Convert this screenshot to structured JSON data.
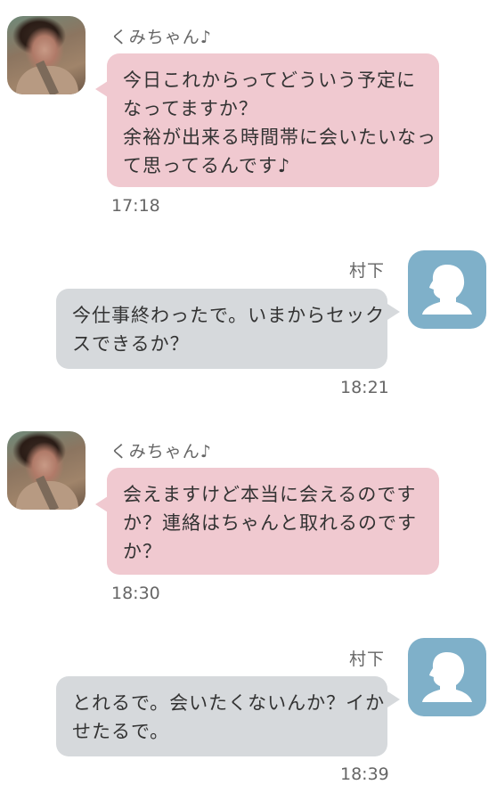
{
  "messages": [
    {
      "sender": "くみちゃん♪",
      "side": "left",
      "lines": [
        "今日これからってどういう予定に",
        "なってますか？",
        "余裕が出来る時間帯に会いたいなっ",
        "て思ってるんです♪"
      ],
      "time": "17:18"
    },
    {
      "sender": "村下",
      "side": "right",
      "lines": [
        "今仕事終わったで。いまからセック",
        "スできるか？"
      ],
      "time": "18:21"
    },
    {
      "sender": "くみちゃん♪",
      "side": "left",
      "lines": [
        "会えますけど本当に会えるのです",
        "か？連絡はちゃんと取れるのです",
        "か？"
      ],
      "time": "18:30"
    },
    {
      "sender": "村下",
      "side": "right",
      "lines": [
        "とれるで。会いたくないんか？イか",
        "せたるで。"
      ],
      "time": "18:39"
    }
  ],
  "colors": {
    "incoming_bubble": "#f0c9d0",
    "outgoing_bubble": "#d6d9dc",
    "silhouette_avatar": "#7fb0c9"
  },
  "icons": {
    "incoming_avatar": "user-photo",
    "outgoing_avatar": "person-silhouette-icon"
  }
}
